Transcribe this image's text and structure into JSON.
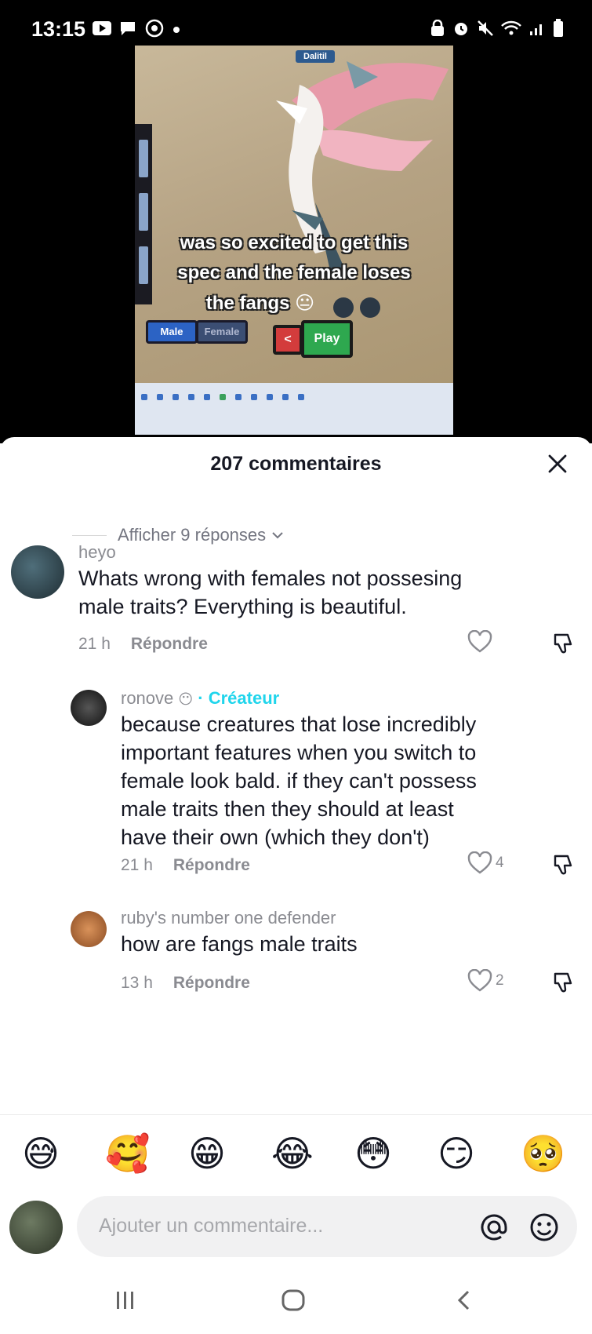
{
  "status_bar": {
    "time": "13:15",
    "left_icons": [
      "play-icon",
      "chat-icon",
      "app-icon",
      "dot-icon"
    ],
    "right_icons": [
      "lock-icon",
      "alarm-icon",
      "mute-icon",
      "wifi-icon",
      "signal-icon",
      "battery-icon"
    ]
  },
  "video": {
    "game_title": "Dalitil",
    "caption_line1": "was so excited to get this",
    "caption_line2": "spec and the female loses",
    "caption_line3": "the fangs",
    "caption_emoji": "😐",
    "male_label": "Male",
    "female_label": "Female",
    "back_label": "<",
    "play_label": "Play"
  },
  "comments_panel": {
    "title": "207 commentaires",
    "show_replies": "Afficher 9 réponses",
    "comments": [
      {
        "username": "heyo",
        "text_line1": "Whats wrong with females not possesing",
        "text_line2": "male traits? Everything is beautiful.",
        "time": "21 h",
        "reply_label": "Répondre",
        "likes": ""
      },
      {
        "username": "ronove",
        "badge": "· Créateur",
        "text_line1": "because creatures that lose incredibly",
        "text_line2": "important features when you switch to",
        "text_line3": "female look bald. if they can't possess",
        "text_line4": "male traits then they should at least",
        "text_line5": "have their own (which they don't)",
        "time": "21 h",
        "reply_label": "Répondre",
        "likes": "4"
      },
      {
        "username": "ruby's number one defender",
        "text_line1": "how are fangs male traits",
        "time": "13 h",
        "reply_label": "Répondre",
        "likes": "2"
      }
    ]
  },
  "emoji_bar": [
    "😅",
    "🥰",
    "😁",
    "😂",
    "😳",
    "😏",
    "🥺"
  ],
  "comment_input": {
    "placeholder": "Ajouter un commentaire..."
  },
  "nav_bar": {
    "icons": [
      "recent-apps-icon",
      "home-icon",
      "back-icon"
    ]
  }
}
